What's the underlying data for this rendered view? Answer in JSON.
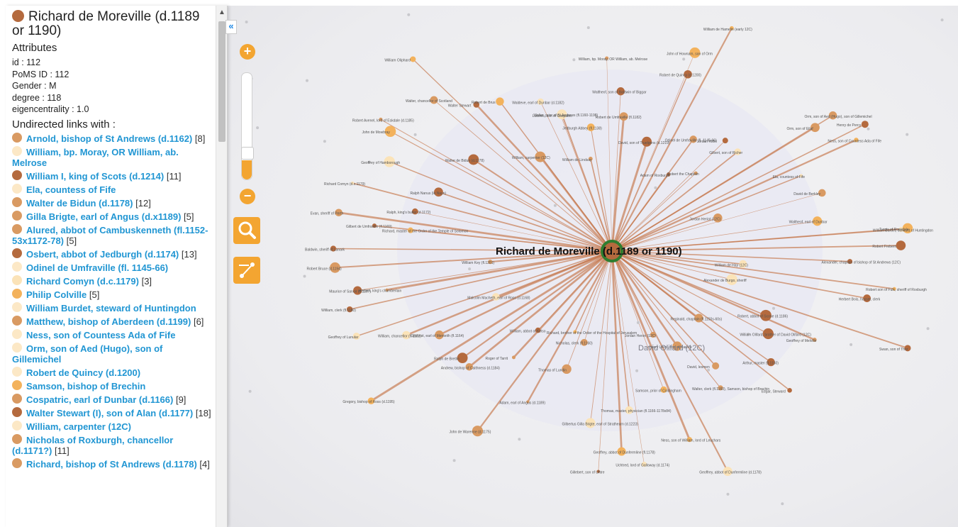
{
  "node": {
    "title": "Richard de Moreville (d.1189 or 1190)",
    "color": "#b46a3e",
    "attributes_heading": "Attributes",
    "attributes": [
      "id : 112",
      "PoMS ID : 112",
      "Gender : M",
      "degree : 118",
      "eigencentrality : 1.0"
    ],
    "links_heading": "Undirected links with :",
    "links": [
      {
        "name": "Arnold, bishop of St Andrews (d.1162)",
        "count": "[8]",
        "dot": "c-mid"
      },
      {
        "name": "William, bp. Moray, OR William, ab. Melrose",
        "count": "",
        "dot": "c-cream"
      },
      {
        "name": "William I, king of Scots (d.1214)",
        "count": "[11]",
        "dot": "c-dark"
      },
      {
        "name": "Ela, countess of Fife",
        "count": "",
        "dot": "c-cream"
      },
      {
        "name": "Walter de Bidun (d.1178)",
        "count": "[12]",
        "dot": "c-mid"
      },
      {
        "name": "Gilla Brigte, earl of Angus (d.x1189)",
        "count": "[5]",
        "dot": "c-mid"
      },
      {
        "name": "Alured, abbot of Cambuskenneth (fl.1152-53x1172-78)",
        "count": "[5]",
        "dot": "c-mid"
      },
      {
        "name": "Osbert, abbot of Jedburgh (d.1174)",
        "count": "[13]",
        "dot": "c-dark"
      },
      {
        "name": "Odinel de Umfraville (fl. 1145-66)",
        "count": "",
        "dot": "c-cream"
      },
      {
        "name": "Richard Comyn (d.c.1179)",
        "count": "[3]",
        "dot": "c-pale"
      },
      {
        "name": "Philip Colville",
        "count": "[5]",
        "dot": "c-orange"
      },
      {
        "name": "William Burdet, steward of Huntingdon",
        "count": "",
        "dot": "c-cream"
      },
      {
        "name": "Matthew, bishop of Aberdeen (d.1199)",
        "count": "[6]",
        "dot": "c-mid"
      },
      {
        "name": "Ness, son of Countess Ada of Fife",
        "count": "",
        "dot": "c-cream"
      },
      {
        "name": "Orm, son of Aed (Hugo), son of Gillemichel",
        "count": "",
        "dot": "c-cream"
      },
      {
        "name": "Robert de Quincy (d.1200)",
        "count": "",
        "dot": "c-cream"
      },
      {
        "name": "Samson, bishop of Brechin",
        "count": "",
        "dot": "c-orange"
      },
      {
        "name": "Cospatric, earl of Dunbar (d.1166)",
        "count": "[9]",
        "dot": "c-mid"
      },
      {
        "name": "Walter Stewart (I), son of Alan (d.1177)",
        "count": "[18]",
        "dot": "c-dark"
      },
      {
        "name": "William, carpenter (12C)",
        "count": "",
        "dot": "c-cream"
      },
      {
        "name": "Nicholas of Roxburgh, chancellor (d.1171?)",
        "count": "[11]",
        "dot": "c-mid"
      },
      {
        "name": "Richard, bishop of St Andrews (d.1178)",
        "count": "[4]",
        "dot": "c-mid"
      }
    ]
  },
  "controls": {
    "collapse": "«",
    "zoom_in": "+",
    "zoom_out": "−",
    "zoom_level": 0.18
  },
  "graph": {
    "center_label": "Richard de Moreville (d.1189 or 1190)",
    "secondary_label": "David Olifard (12C)",
    "edge_color": "#c26a3a",
    "node_colors": [
      "#b46a3e",
      "#d99a62",
      "#f3b25c",
      "#fbe3b8"
    ],
    "labels": [
      "Alexander, chaplain of bishop of St Andrews (12C)",
      "William de Hay (12C)",
      "Robert son of Fulk, sheriff of Roxburgh",
      "Herbert Bois, hosser, clerk",
      "Alexander de Burgo, sheriff",
      "Swan, son of Thor",
      "Robert, abbot of Scone (d.1186)",
      "Geoffrey of Melville",
      "William Olifard, brother of David Olifard (12C)",
      "Arthur, master (fl.1150)",
      "Edgar, Steward",
      "Reginald, chaplain (fl.1150s-60s)",
      "David, lesmen",
      "Walter, clerk (fl.1160), Samson, bishop of Brechin",
      "Henry Lovel, lord of Hawick",
      "Geoffrey, abbot of Dunfermline (d.1178)",
      "Jordan Heron (12C)",
      "Ness, son of William, lord of Leuchars",
      "Samson, prior of Coldingham",
      "Thomas, master, physician (fl.1166-1178x84)",
      "Uchtred, lord of Galloway (d.1174)",
      "Geoffrey, abbot of Dunfermline (fl.1178)",
      "Gillebert, son of Uhtre",
      "Gilbertus Gilla Brigte, earl of Strathearn (d.1223)",
      "Nicholas, clerk (fl.1160)",
      "Thomas of Lundin",
      "Richard, brother of the Order of the Hospital of Jerusalem",
      "Adam, earl of Angus (d.1189)",
      "John de Warenne (d.1175)",
      "Roger of Tarrit",
      "William, abbot of Kelso",
      "Andrew, bishop of Caithness (d.1184)",
      "Ralph de Bretlin",
      "Gregory, bishop of Ross (d.1195)",
      "Gilchrist, earl of Menteith (fl.1164)",
      "William, chancellor (fl.1182)",
      "Malcolm Macheth, earl of Ross (d.1168)",
      "Geoffrey of Lunular",
      "William, clerk (fl.1180)",
      "Maurice of Sanoir (d.1197)",
      "Herbert, king's chamberlain",
      "William Key (fl.1201)",
      "Robert Bruce (d.1194)",
      "Baldwin, sheriff of Lanark",
      "Gilbert de Umfraville (fl.1169)",
      "Richard, master of the Order of the Temple of Solomon",
      "Evan, sheriff of Perth",
      "Ralph, king's butler (d.1172)",
      "Richard Comyn (d.c.1179)",
      "Ralph Nanus (le Nayn)",
      "Geoffrey of Hamborough",
      "Robert Avenel, lord of Eskdale (d.1185)",
      "John de Mowbray",
      "Walter de Bidun (d.1178)",
      "Walter, chancellor of Scotland",
      "William Oliphard",
      "Walter Stewart",
      "Robert de Brus",
      "William, carpenter (12C)",
      "Waldeve, earl of Dunbar (d.1182)",
      "Ludovic, son of Cospatric",
      "Walter, prior of St Andrews (fl.1160-1198)",
      "William de Lindsay",
      "Jedburgh Abbey (fl.1138)",
      "William, bp. Moray, OR William, ab. Melrose",
      "Waltheof, son of Baldwin of Biggar",
      "Robert de Umfraville (fl.1182)",
      "David, son of Truelgens (d.1219)",
      "John of Hownam, son of Orm",
      "Robert de Quincy (d.1200)",
      "William de Hamelin (early 12C)",
      "Adam of Roxburgh",
      "Odinel de Umfraville (fl. 1145-66)",
      "Robert the Chaplain",
      "Jordan Ridel",
      "Gilbert, son of Richer",
      "Orm, son of Eilaf",
      "Orm, son of Aed (Hugo), son of Gillemichel",
      "Henry de Percy",
      "Ness, son of Countess Ada of Fife",
      "Ela, countess of Fife",
      "Jordan Heriot (12C)",
      "David de Berkley",
      "Waltheof, earl of Dunbar",
      "William Burdet, steward of Huntingdon",
      "Turgis of Rossdale",
      "Robert Frebern"
    ]
  }
}
